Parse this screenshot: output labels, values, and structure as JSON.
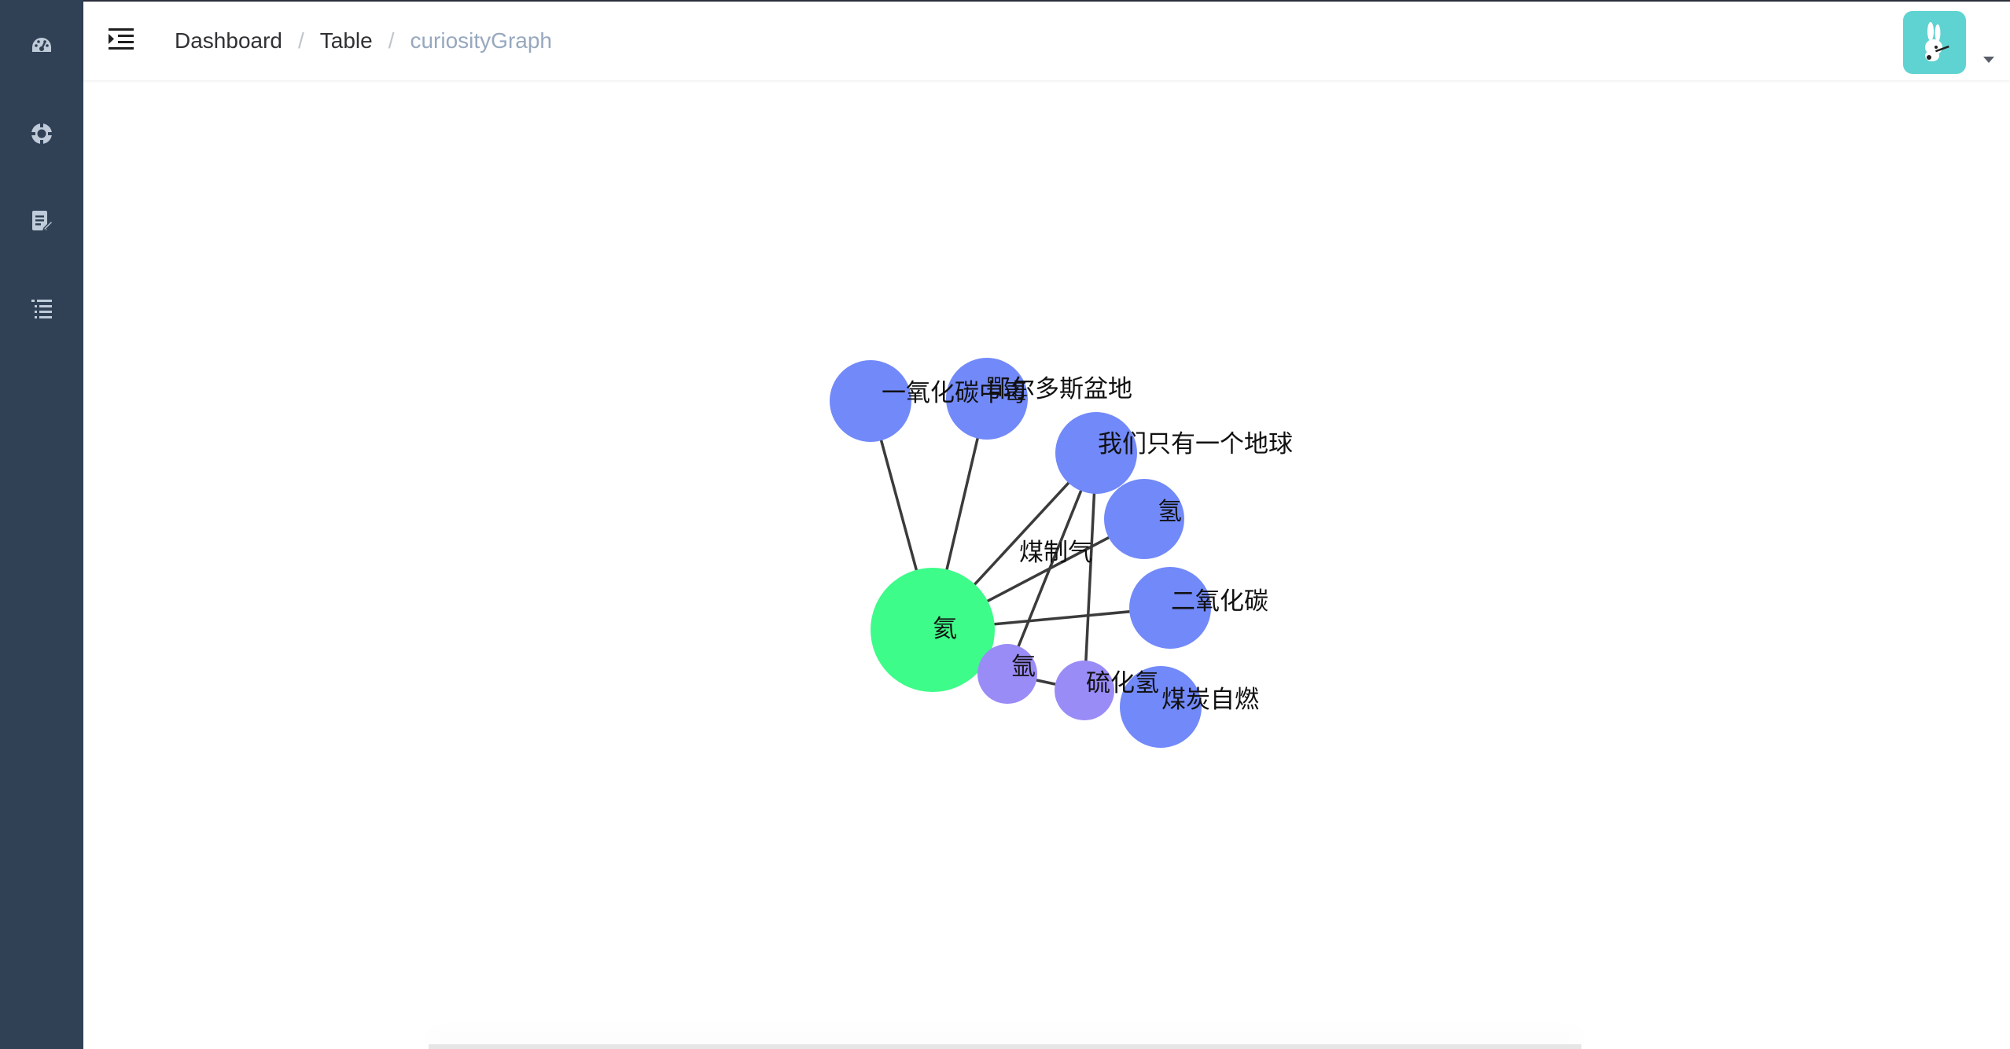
{
  "sidebar": {
    "items": [
      {
        "name": "dashboard",
        "icon": "dashboard-icon"
      },
      {
        "name": "help",
        "icon": "lifebuoy-icon"
      },
      {
        "name": "form",
        "icon": "document-edit-icon"
      },
      {
        "name": "list",
        "icon": "list-icon"
      }
    ]
  },
  "header": {
    "breadcrumb": [
      "Dashboard",
      "Table",
      "curiosityGraph"
    ],
    "separator": "/",
    "avatar_icon": "rabbit-avatar-icon"
  },
  "graph": {
    "colors": {
      "center": "#3dfc89",
      "primary": "#7289f9",
      "secondary": "#9a8cf7",
      "edge": "#3b3b3b"
    },
    "nodes": [
      {
        "id": "center",
        "label": "氦",
        "kind": "center"
      },
      {
        "id": "n1",
        "label": "一氧化碳中毒",
        "kind": "primary"
      },
      {
        "id": "n2",
        "label": "鄂尔多斯盆地",
        "kind": "primary"
      },
      {
        "id": "n3",
        "label": "我们只有一个地球",
        "kind": "primary"
      },
      {
        "id": "n4",
        "label": "氢",
        "kind": "primary"
      },
      {
        "id": "n5",
        "label": "二氧化碳",
        "kind": "primary"
      },
      {
        "id": "n6",
        "label": "煤炭自燃",
        "kind": "primary"
      },
      {
        "id": "n7",
        "label": "氩",
        "kind": "secondary"
      },
      {
        "id": "n8",
        "label": "硫化氢",
        "kind": "secondary"
      },
      {
        "id": "t1",
        "label": "煤制气",
        "kind": "text"
      }
    ],
    "edges": [
      [
        "center",
        "n1"
      ],
      [
        "center",
        "n2"
      ],
      [
        "center",
        "n3"
      ],
      [
        "center",
        "n4"
      ],
      [
        "center",
        "n5"
      ],
      [
        "n7",
        "n3"
      ],
      [
        "n8",
        "n3"
      ],
      [
        "n7",
        "n8"
      ]
    ]
  }
}
